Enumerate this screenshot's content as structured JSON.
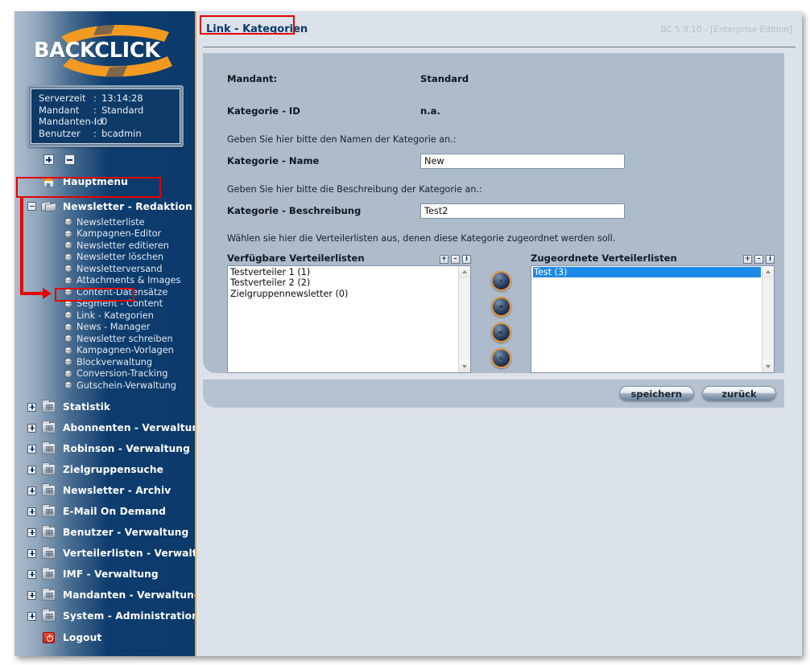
{
  "app": {
    "logo_text": "BACKCLICK",
    "version_label": "BC 5.9.10 - [Enterprise Edition]"
  },
  "server_info": {
    "rows": [
      {
        "key": "Serverzeit",
        "sep": ":",
        "value": "13:14:28"
      },
      {
        "key": "Mandant",
        "sep": ":",
        "value": "Standard"
      },
      {
        "key": "Mandanten-Id",
        "sep": ":",
        "value": "0"
      },
      {
        "key": "Benutzer",
        "sep": ":",
        "value": "bcadmin"
      }
    ]
  },
  "sidebar": {
    "tree_toolbar": {
      "expand_all": "+",
      "collapse_all": "-"
    },
    "home": {
      "label": "Hauptmenü"
    },
    "expanded_section": {
      "label": "Newsletter - Redaktion",
      "items": [
        {
          "label": "Newsletterliste"
        },
        {
          "label": "Kampagnen-Editor"
        },
        {
          "label": "Newsletter editieren"
        },
        {
          "label": "Newsletter löschen"
        },
        {
          "label": "Newsletterversand"
        },
        {
          "label": "Attachments & Images"
        },
        {
          "label": "Content-Datensätze"
        },
        {
          "label": "Segment - Content"
        },
        {
          "label": "Link - Kategorien"
        },
        {
          "label": "News - Manager"
        },
        {
          "label": "Newsletter schreiben"
        },
        {
          "label": "Kampagnen-Vorlagen"
        },
        {
          "label": "Blockverwaltung"
        },
        {
          "label": "Conversion-Tracking"
        },
        {
          "label": "Gutschein-Verwaltung"
        }
      ]
    },
    "sections": [
      {
        "label": "Statistik"
      },
      {
        "label": "Abonnenten - Verwaltung"
      },
      {
        "label": "Robinson - Verwaltung"
      },
      {
        "label": "Zielgruppensuche"
      },
      {
        "label": "Newsletter - Archiv"
      },
      {
        "label": "E-Mail On Demand"
      },
      {
        "label": "Benutzer - Verwaltung"
      },
      {
        "label": "Verteilerlisten - Verwaltung"
      },
      {
        "label": "IMF - Verwaltung"
      },
      {
        "label": "Mandanten - Verwaltung"
      },
      {
        "label": "System - Administration"
      }
    ],
    "logout": {
      "label": "Logout"
    }
  },
  "page": {
    "title": "Link - Kategorien"
  },
  "form": {
    "mandant_label": "Mandant:",
    "mandant_value": "Standard",
    "kategorie_id_label": "Kategorie - ID",
    "kategorie_id_value": "n.a.",
    "name_hint": "Geben Sie hier bitte den Namen der Kategorie an.:",
    "name_label": "Kategorie - Name",
    "name_value": "New",
    "desc_hint": "Geben Sie hier bitte die Beschreibung der Kategorie an.:",
    "desc_label": "Kategorie - Beschreibung",
    "desc_value": "Test2",
    "lists_hint": "Wählen sie hier die Verteilerlisten aus, denen diese Kategorie zugeordnet werden soll."
  },
  "dual_list": {
    "mini_buttons": [
      {
        "glyph": "+",
        "name": "expand"
      },
      {
        "glyph": "–",
        "name": "collapse"
      },
      {
        "glyph": "i",
        "name": "info"
      }
    ],
    "available": {
      "title": "Verfügbare Verteilerlisten",
      "items": [
        {
          "label": "Testverteiler 1 (1)",
          "selected": false
        },
        {
          "label": "Testverteiler 2 (2)",
          "selected": false
        },
        {
          "label": "Zielgruppennewsletter (0)",
          "selected": false
        }
      ]
    },
    "assigned": {
      "title": "Zugeordnete Verteilerlisten",
      "items": [
        {
          "label": "Test (3)",
          "selected": true
        }
      ]
    },
    "transfer_buttons": [
      {
        "glyph": "›",
        "name": "move-right"
      },
      {
        "glyph": "»",
        "name": "move-all-right"
      },
      {
        "glyph": "«",
        "name": "move-all-left"
      },
      {
        "glyph": "‹",
        "name": "move-left"
      }
    ]
  },
  "actions": {
    "save_label": "speichern",
    "back_label": "zurück"
  },
  "colors": {
    "accent_orange": "#e8a735",
    "nav_dark_blue": "#0b3a6b",
    "panel_blue_gray": "#adbbcb",
    "selection_blue": "#1e8ae8",
    "annotation_red": "#e60000"
  }
}
